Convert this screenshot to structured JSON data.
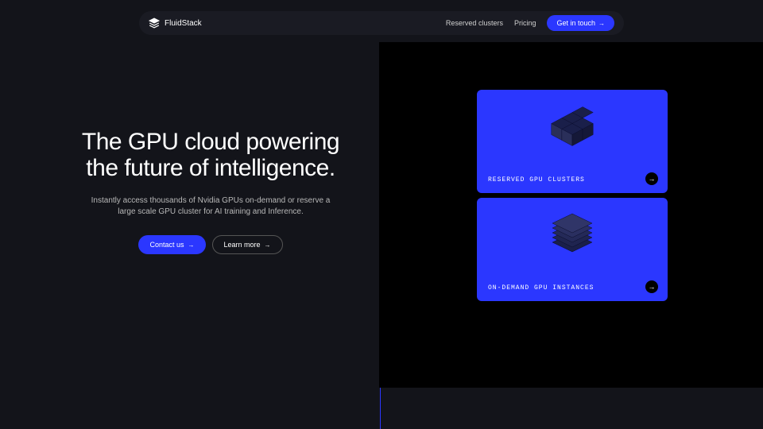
{
  "brand": {
    "name": "FluidStack"
  },
  "nav": {
    "links": {
      "reserved": "Reserved clusters",
      "pricing": "Pricing"
    },
    "cta": "Get in touch"
  },
  "hero": {
    "title": "The GPU cloud powering the future of intelligence.",
    "subtitle": "Instantly access thousands of Nvidia GPUs on-demand or reserve a large scale GPU cluster for AI training and Inference.",
    "primary_btn": "Contact us",
    "secondary_btn": "Learn more"
  },
  "cards": {
    "reserved": "RESERVED GPU CLUSTERS",
    "ondemand": "ON-DEMAND GPU INSTANCES"
  },
  "colors": {
    "accent": "#2b37ff",
    "bg": "#13141a",
    "panel": "#000000"
  }
}
